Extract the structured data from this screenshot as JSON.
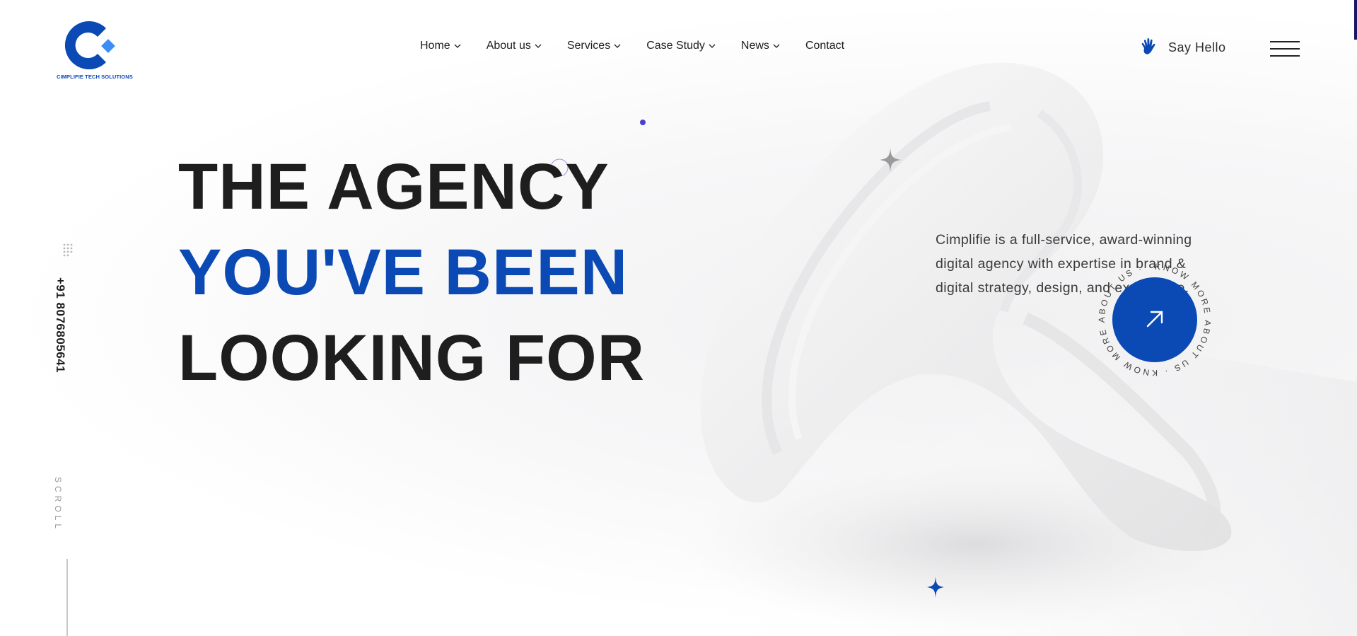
{
  "brand": {
    "name": "CIMPLIFIE TECH SOLUTIONS",
    "colors": {
      "primary": "#0b49b5",
      "accent": "#3a8ef5",
      "dark": "#1e1e1e"
    }
  },
  "nav": {
    "items": [
      {
        "label": "Home",
        "dropdown": true
      },
      {
        "label": "About us",
        "dropdown": true
      },
      {
        "label": "Services",
        "dropdown": true
      },
      {
        "label": "Case Study",
        "dropdown": true
      },
      {
        "label": "News",
        "dropdown": true
      },
      {
        "label": "Contact",
        "dropdown": false
      }
    ]
  },
  "header": {
    "say_hello": "Say Hello",
    "say_hello_icon": "waving-hand-icon",
    "menu_icon": "hamburger-icon"
  },
  "hero": {
    "line1": "THE AGENCY",
    "line2": "YOU'VE BEEN",
    "line3": "LOOKING FOR"
  },
  "intro": {
    "text": "Cimplifie is a full-service, award-winning digital agency with expertise in brand & digital strategy, design, and experience."
  },
  "know_more": {
    "ring_text": "KNOW MORE ABOUT US · KNOW MORE ABOUT US · ",
    "icon": "arrow-up-right-icon"
  },
  "sidebar": {
    "phone": "+91 8076805641",
    "scroll_label": "SCROLL"
  }
}
